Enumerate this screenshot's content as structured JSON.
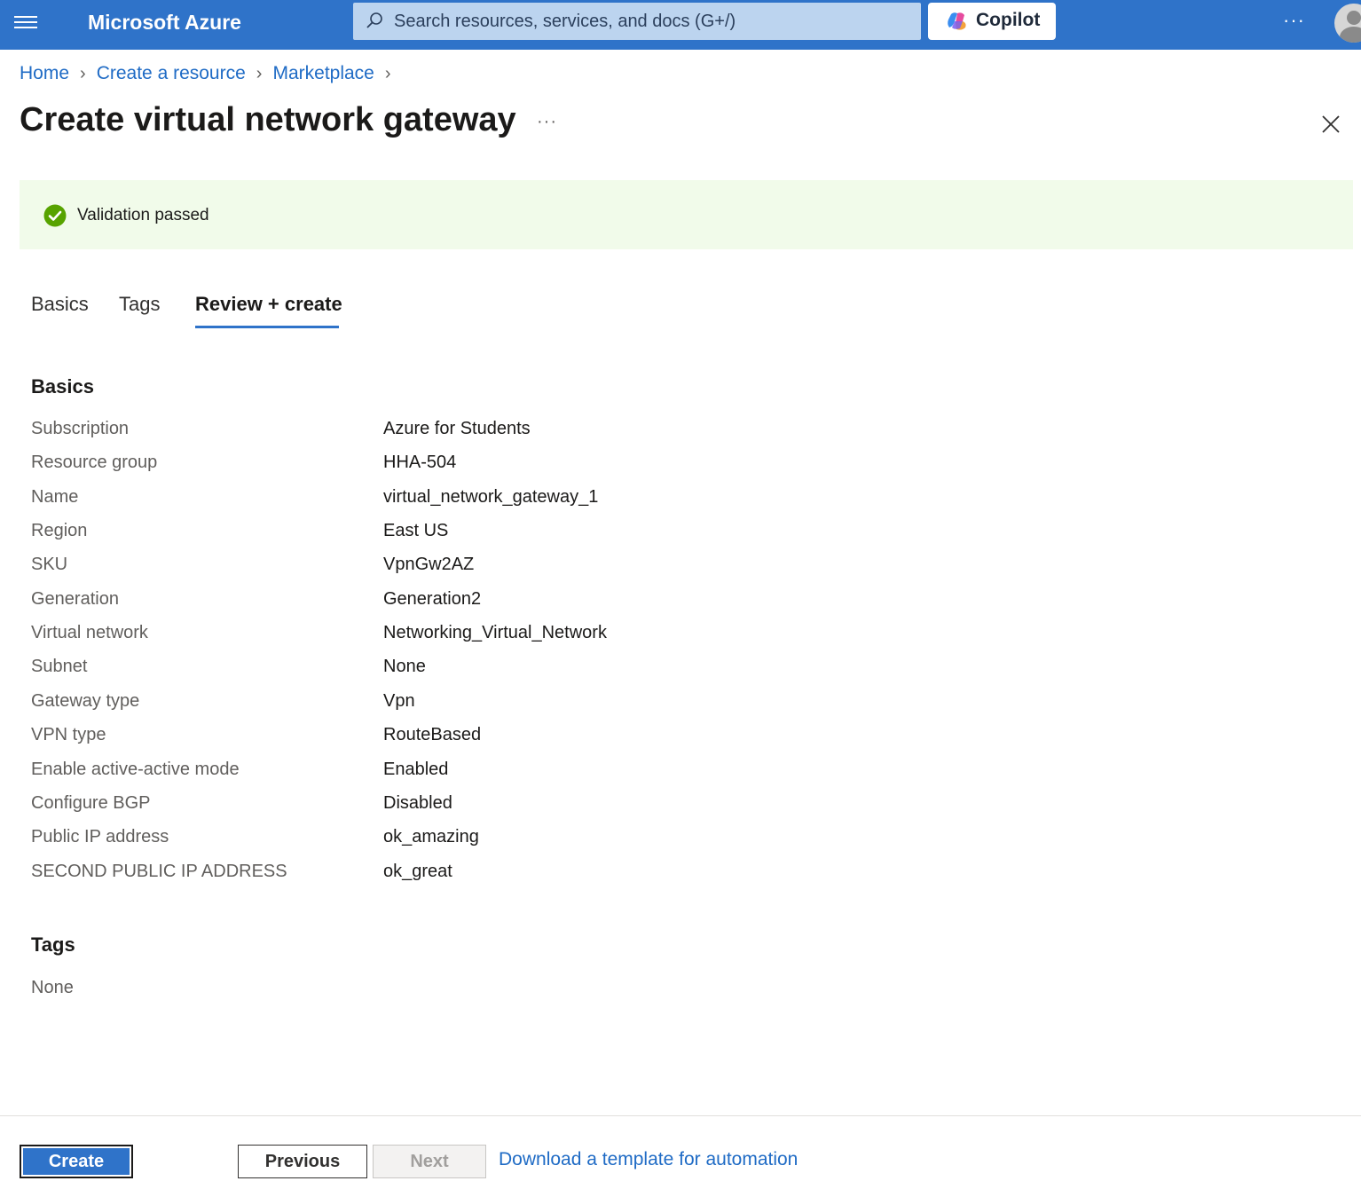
{
  "topbar": {
    "brand": "Microsoft Azure",
    "search_placeholder": "Search resources, services, and docs (G+/)",
    "copilot_label": "Copilot",
    "more_label": "···"
  },
  "breadcrumb": [
    "Home",
    "Create a resource",
    "Marketplace"
  ],
  "page": {
    "title": "Create virtual network gateway",
    "more_label": "···"
  },
  "validation": {
    "message": "Validation passed",
    "status_color": "#57a300"
  },
  "tabs": [
    {
      "label": "Basics",
      "active": false
    },
    {
      "label": "Tags",
      "active": false
    },
    {
      "label": "Review + create",
      "active": true
    }
  ],
  "basics": {
    "title": "Basics",
    "rows": [
      {
        "label": "Subscription",
        "value": "Azure for Students"
      },
      {
        "label": "Resource group",
        "value": "HHA-504"
      },
      {
        "label": "Name",
        "value": "virtual_network_gateway_1"
      },
      {
        "label": "Region",
        "value": "East US"
      },
      {
        "label": "SKU",
        "value": "VpnGw2AZ"
      },
      {
        "label": "Generation",
        "value": "Generation2"
      },
      {
        "label": "Virtual network",
        "value": "Networking_Virtual_Network"
      },
      {
        "label": "Subnet",
        "value": "None"
      },
      {
        "label": "Gateway type",
        "value": "Vpn"
      },
      {
        "label": "VPN type",
        "value": "RouteBased"
      },
      {
        "label": "Enable active-active mode",
        "value": "Enabled"
      },
      {
        "label": "Configure BGP",
        "value": "Disabled"
      },
      {
        "label": "Public IP address",
        "value": "ok_amazing"
      },
      {
        "label": "SECOND PUBLIC IP ADDRESS",
        "value": "ok_great"
      }
    ]
  },
  "tags": {
    "title": "Tags",
    "value": "None"
  },
  "footer": {
    "create_label": "Create",
    "previous_label": "Previous",
    "next_label": "Next",
    "download_label": "Download a template for automation"
  },
  "colors": {
    "accent": "#2f73c9",
    "link": "#1f6bc5",
    "banner_bg": "#f1fbea"
  }
}
